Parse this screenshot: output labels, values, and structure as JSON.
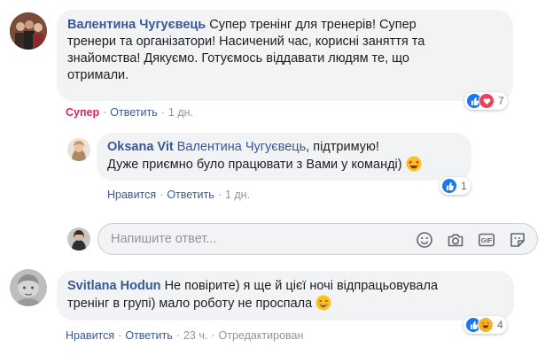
{
  "comments": [
    {
      "author": "Валентина Чугуєвець",
      "text": "Супер тренінг для тренерів! Супер тренери та організатори! Насичений час, корисні заняття та знайомства! Дякуємо. Готуємось віддавати людям те, що отримали.",
      "lines": [
        "Супер тренінг для тренерів! Супер",
        "тренери та організатори! Насичений час, корисні заняття та",
        "знайомства! Дякуємо. Готуємось віддавати людям те, що",
        "отримали."
      ],
      "actions": {
        "reaction": "Супер",
        "reply": "Ответить",
        "time": "1 дн."
      },
      "reactions": {
        "icons": [
          "like",
          "love"
        ],
        "count": "7"
      }
    },
    {
      "author": "Oksana Vit",
      "mention": "Валентина Чугуєвець",
      "text_line1": ", підтримую!",
      "text_line2": "Дуже приємно було працювати з Вами у команді)",
      "emoji": "heart-eyes-emoji",
      "actions": {
        "like": "Нравится",
        "reply": "Ответить",
        "time": "1 дн."
      },
      "reactions": {
        "icons": [
          "like"
        ],
        "count": "1"
      }
    },
    {
      "author": "Svitlana Hodun",
      "line1": "Не повірите) я ще й цієї ночі відпрацьовувала",
      "line2": "тренінг в групі) мало роботу не проспала",
      "emoji": "grin-emoji",
      "actions": {
        "like": "Нравится",
        "reply": "Ответить",
        "time": "23 ч.",
        "edited": "Отредактирован"
      },
      "reactions": {
        "icons": [
          "like",
          "haha"
        ],
        "count": "4"
      }
    }
  ],
  "reply_box": {
    "placeholder": "Напишите ответ...",
    "tools": [
      "smiley-icon",
      "camera-icon",
      "gif-icon",
      "sticker-icon"
    ]
  },
  "colors": {
    "link": "#385898",
    "super": "#e0245e",
    "bubble": "#f2f3f5",
    "like": "#1877f2",
    "love": "#f33e58",
    "haha": "#f7b125"
  }
}
